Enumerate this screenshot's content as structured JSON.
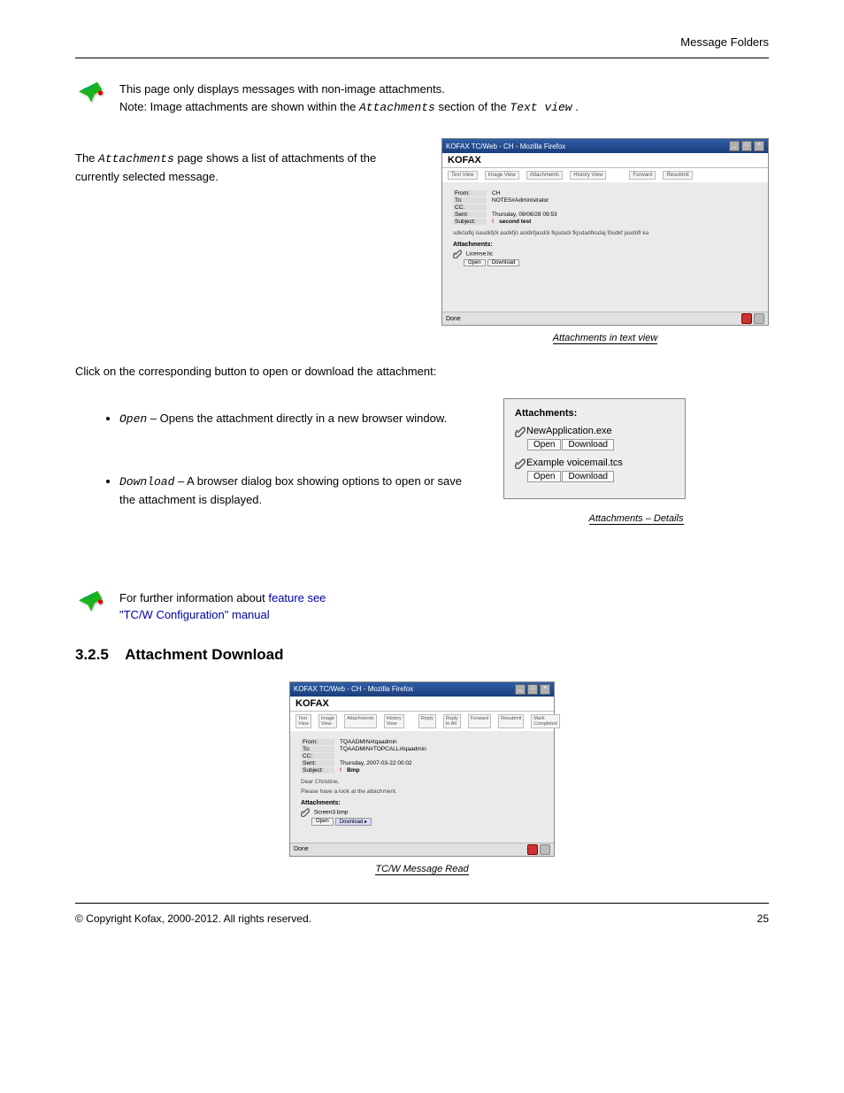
{
  "header_right": "Message Folders",
  "note1": {
    "line1": "This page only displays messages with non-image attachments.",
    "line2_pre": "Note: Image attachments are shown within the ",
    "line2_att": "Attachments",
    "line2_mid": " section of the ",
    "line2_tv": "Text view",
    "line2_end": "."
  },
  "para1_pre": "The ",
  "para1_att": "Attachments",
  "para1_post": " page shows a list of attachments of the currently selected message.",
  "fig1": {
    "title": "KOFAX TC/Web - CH - Mozilla Firefox",
    "brand": "KOFAX",
    "tabs": [
      "Text View",
      "Image View",
      "Attachments",
      "History View"
    ],
    "actions": [
      "Forward",
      "Resubmit"
    ],
    "from": "CH",
    "to": "NOTES#Administrator",
    "cc": "",
    "sent": "Thursday, 09/06/28 09:53",
    "subject": "second test",
    "msg": "sdköafkj öasdkfjöl asdkfjö asldkfjasdöl fkjsdaöl fkjsdaöfksdaj fösdkf jasdöfl ka",
    "att_header": "Attachments:",
    "att_file": "License.lic",
    "open": "Open",
    "download": "Download",
    "done": "Done",
    "caption": "Attachments in text view"
  },
  "para2": "Click on the corresponding button to open or download the attachment:",
  "bullets": {
    "open_label": "Open",
    "open_text": " – Opens the attachment directly in a new browser window.",
    "download_label": "Download",
    "download_text": " – A browser dialog box showing options to open or save the attachment is displayed."
  },
  "attbox": {
    "title": "Attachments:",
    "file1": "NewApplication.exe",
    "file2": "Example voicemail.tcs",
    "open": "Open",
    "download": "Download",
    "caption": "Attachments – Details"
  },
  "note2_pre": "For further information about ",
  "note2_link": "feature see \"TC/W Configuration\" manual",
  "section_num": "3.2.5",
  "section_title": "Attachment Download",
  "fig2": {
    "title": "KOFAX TC/Web - CH - Mozilla Firefox",
    "brand": "KOFAX",
    "tabs": [
      "Text View",
      "Image View",
      "Attachments",
      "History View"
    ],
    "actions": [
      "Reply",
      "Reply to All",
      "Forward",
      "Resubmit",
      "Mark Completed"
    ],
    "from": "TQAADMIN#tqaadmin",
    "to": "TQAADMIN#TOPCALL#tqaadmin",
    "cc": "",
    "sent": "Thursday, 2007-03-22 00:02",
    "subject": "Bmp",
    "body1": "Dear Christine,",
    "body2": "Please have a look at the attachment.",
    "att_header": "Attachments:",
    "att_file": "Screen3.bmp",
    "open": "Open",
    "download": "Download ▸",
    "done": "Done",
    "caption": "TC/W Message Read"
  },
  "footer_left": "© Copyright Kofax, 2000-2012. All rights reserved.",
  "footer_right": "25"
}
